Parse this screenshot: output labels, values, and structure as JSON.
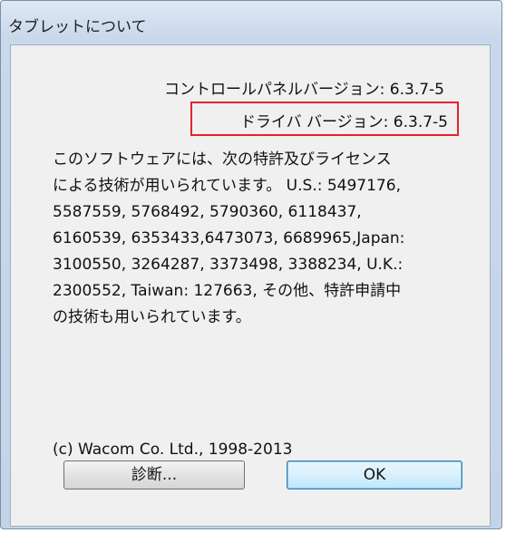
{
  "window": {
    "title": "タブレットについて"
  },
  "versions": {
    "control_panel": "コントロールパネルバージョン: 6.3.7-5",
    "driver": "ドライバ バージョン: 6.3.7-5"
  },
  "body": {
    "lines": [
      "このソフトウェアには、次の特許及びライセンス",
      "による技術が用いられています。 U.S.: 5497176,",
      "5587559, 5768492, 5790360, 6118437,",
      "6160539, 6353433,6473073, 6689965,Japan:",
      "3100550, 3264287, 3373498, 3388234, U.K.:",
      "2300552, Taiwan: 127663, その他、特許申請中",
      "の技術も用いられています。"
    ]
  },
  "copyright": "(c) Wacom Co. Ltd., 1998-2013",
  "buttons": {
    "diagnose": "診断...",
    "ok": "OK"
  },
  "colors": {
    "highlight_box": "#e3232c",
    "ok_button_border": "#3c7fb1"
  }
}
